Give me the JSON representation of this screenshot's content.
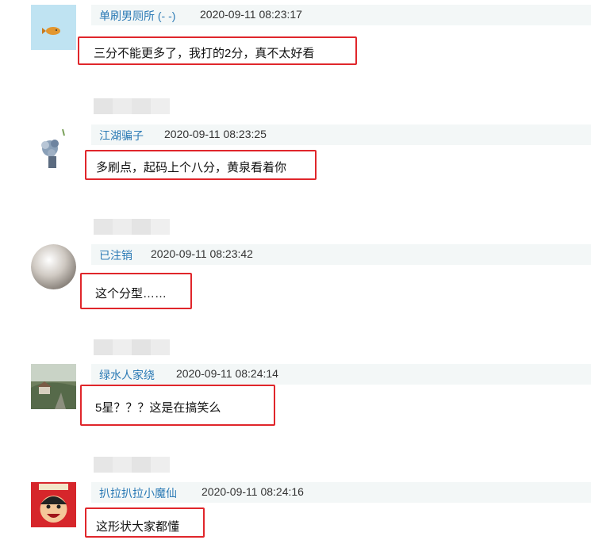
{
  "comments": [
    {
      "username": "单刷男厕所 (- -)",
      "timestamp": "2020-09-11 08:23:17",
      "text": "三分不能更多了，我打的2分，真不太好看",
      "avatar_icon": "orange-fish-avatar"
    },
    {
      "username": "江湖骗子",
      "timestamp": "2020-09-11 08:23:25",
      "text": "多刷点，起码上个八分，黄泉看着你",
      "avatar_icon": "flower-vase-avatar"
    },
    {
      "username": "已注销",
      "timestamp": "2020-09-11 08:23:42",
      "text": "这个分型……",
      "avatar_icon": "pearl-avatar"
    },
    {
      "username": "绿水人家绕",
      "timestamp": "2020-09-11 08:24:14",
      "text": "5星？？？这是在搞笑么",
      "avatar_icon": "landscape-painting-avatar"
    },
    {
      "username": "扒拉扒拉小魔仙",
      "timestamp": "2020-09-11 08:24:16",
      "text": "这形状大家都懂",
      "avatar_icon": "cartoon-boy-avatar"
    }
  ],
  "colors": {
    "highlight_border": "#e0262b",
    "username": "#2b7ab5",
    "header_bg": "#f3f7f7"
  }
}
